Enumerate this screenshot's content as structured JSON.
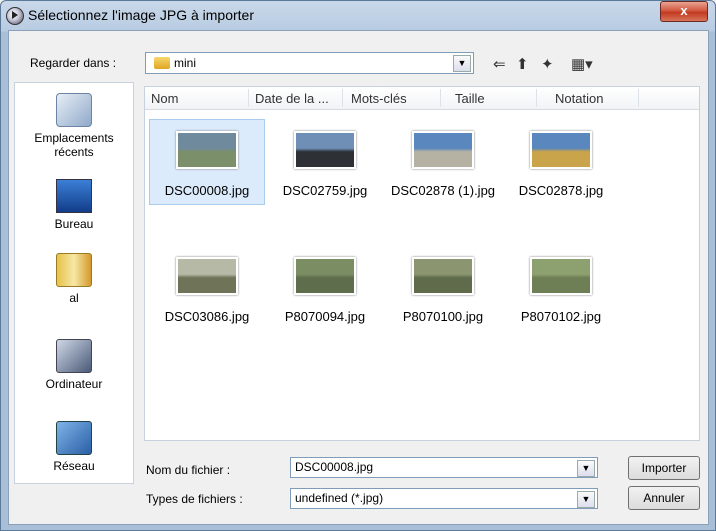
{
  "window": {
    "title": "Sélectionnez l'image JPG à importer",
    "close_label": "x"
  },
  "lookin": {
    "label": "Regarder dans :",
    "value": "mini",
    "arrow": "▼"
  },
  "toolbar": {
    "back_glyph": "⇐",
    "up_glyph": "⬆",
    "newfolder_glyph": "✦",
    "view_glyph": "▦▾"
  },
  "places": [
    {
      "label": "Emplacements récents",
      "icon": "recent-places-icon"
    },
    {
      "label": "Bureau",
      "icon": "desktop-icon"
    },
    {
      "label": "al",
      "icon": "user-folder-icon"
    },
    {
      "label": "Ordinateur",
      "icon": "computer-icon"
    },
    {
      "label": "Réseau",
      "icon": "network-icon"
    }
  ],
  "columns": [
    "Nom",
    "Date de la ...",
    "Mots-clés",
    "Taille",
    "Notation"
  ],
  "files": [
    {
      "name": "DSC00008.jpg",
      "colors": [
        "#6f8a9d",
        "#7b8f6a"
      ],
      "selected": true
    },
    {
      "name": "DSC02759.jpg",
      "colors": [
        "#6f8fb7",
        "#2d3136"
      ]
    },
    {
      "name": "DSC02878 (1).jpg",
      "colors": [
        "#5a87bd",
        "#b5b2a3"
      ]
    },
    {
      "name": "DSC02878.jpg",
      "colors": [
        "#5a87bd",
        "#c9a44a"
      ]
    },
    {
      "name": "DSC03086.jpg",
      "colors": [
        "#b7b9a7",
        "#6f7358"
      ]
    },
    {
      "name": "P8070094.jpg",
      "colors": [
        "#7a8d63",
        "#5e6d4b"
      ]
    },
    {
      "name": "P8070100.jpg",
      "colors": [
        "#8b9670",
        "#5f6b4a"
      ]
    },
    {
      "name": "P8070102.jpg",
      "colors": [
        "#8ca070",
        "#6f7f55"
      ]
    }
  ],
  "filename": {
    "label": "Nom du fichier :",
    "value": "DSC00008.jpg"
  },
  "filetype": {
    "label": "Types de fichiers :",
    "value": "undefined (*.jpg)"
  },
  "buttons": {
    "open": "Importer",
    "cancel": "Annuler"
  },
  "arrow": "▼"
}
